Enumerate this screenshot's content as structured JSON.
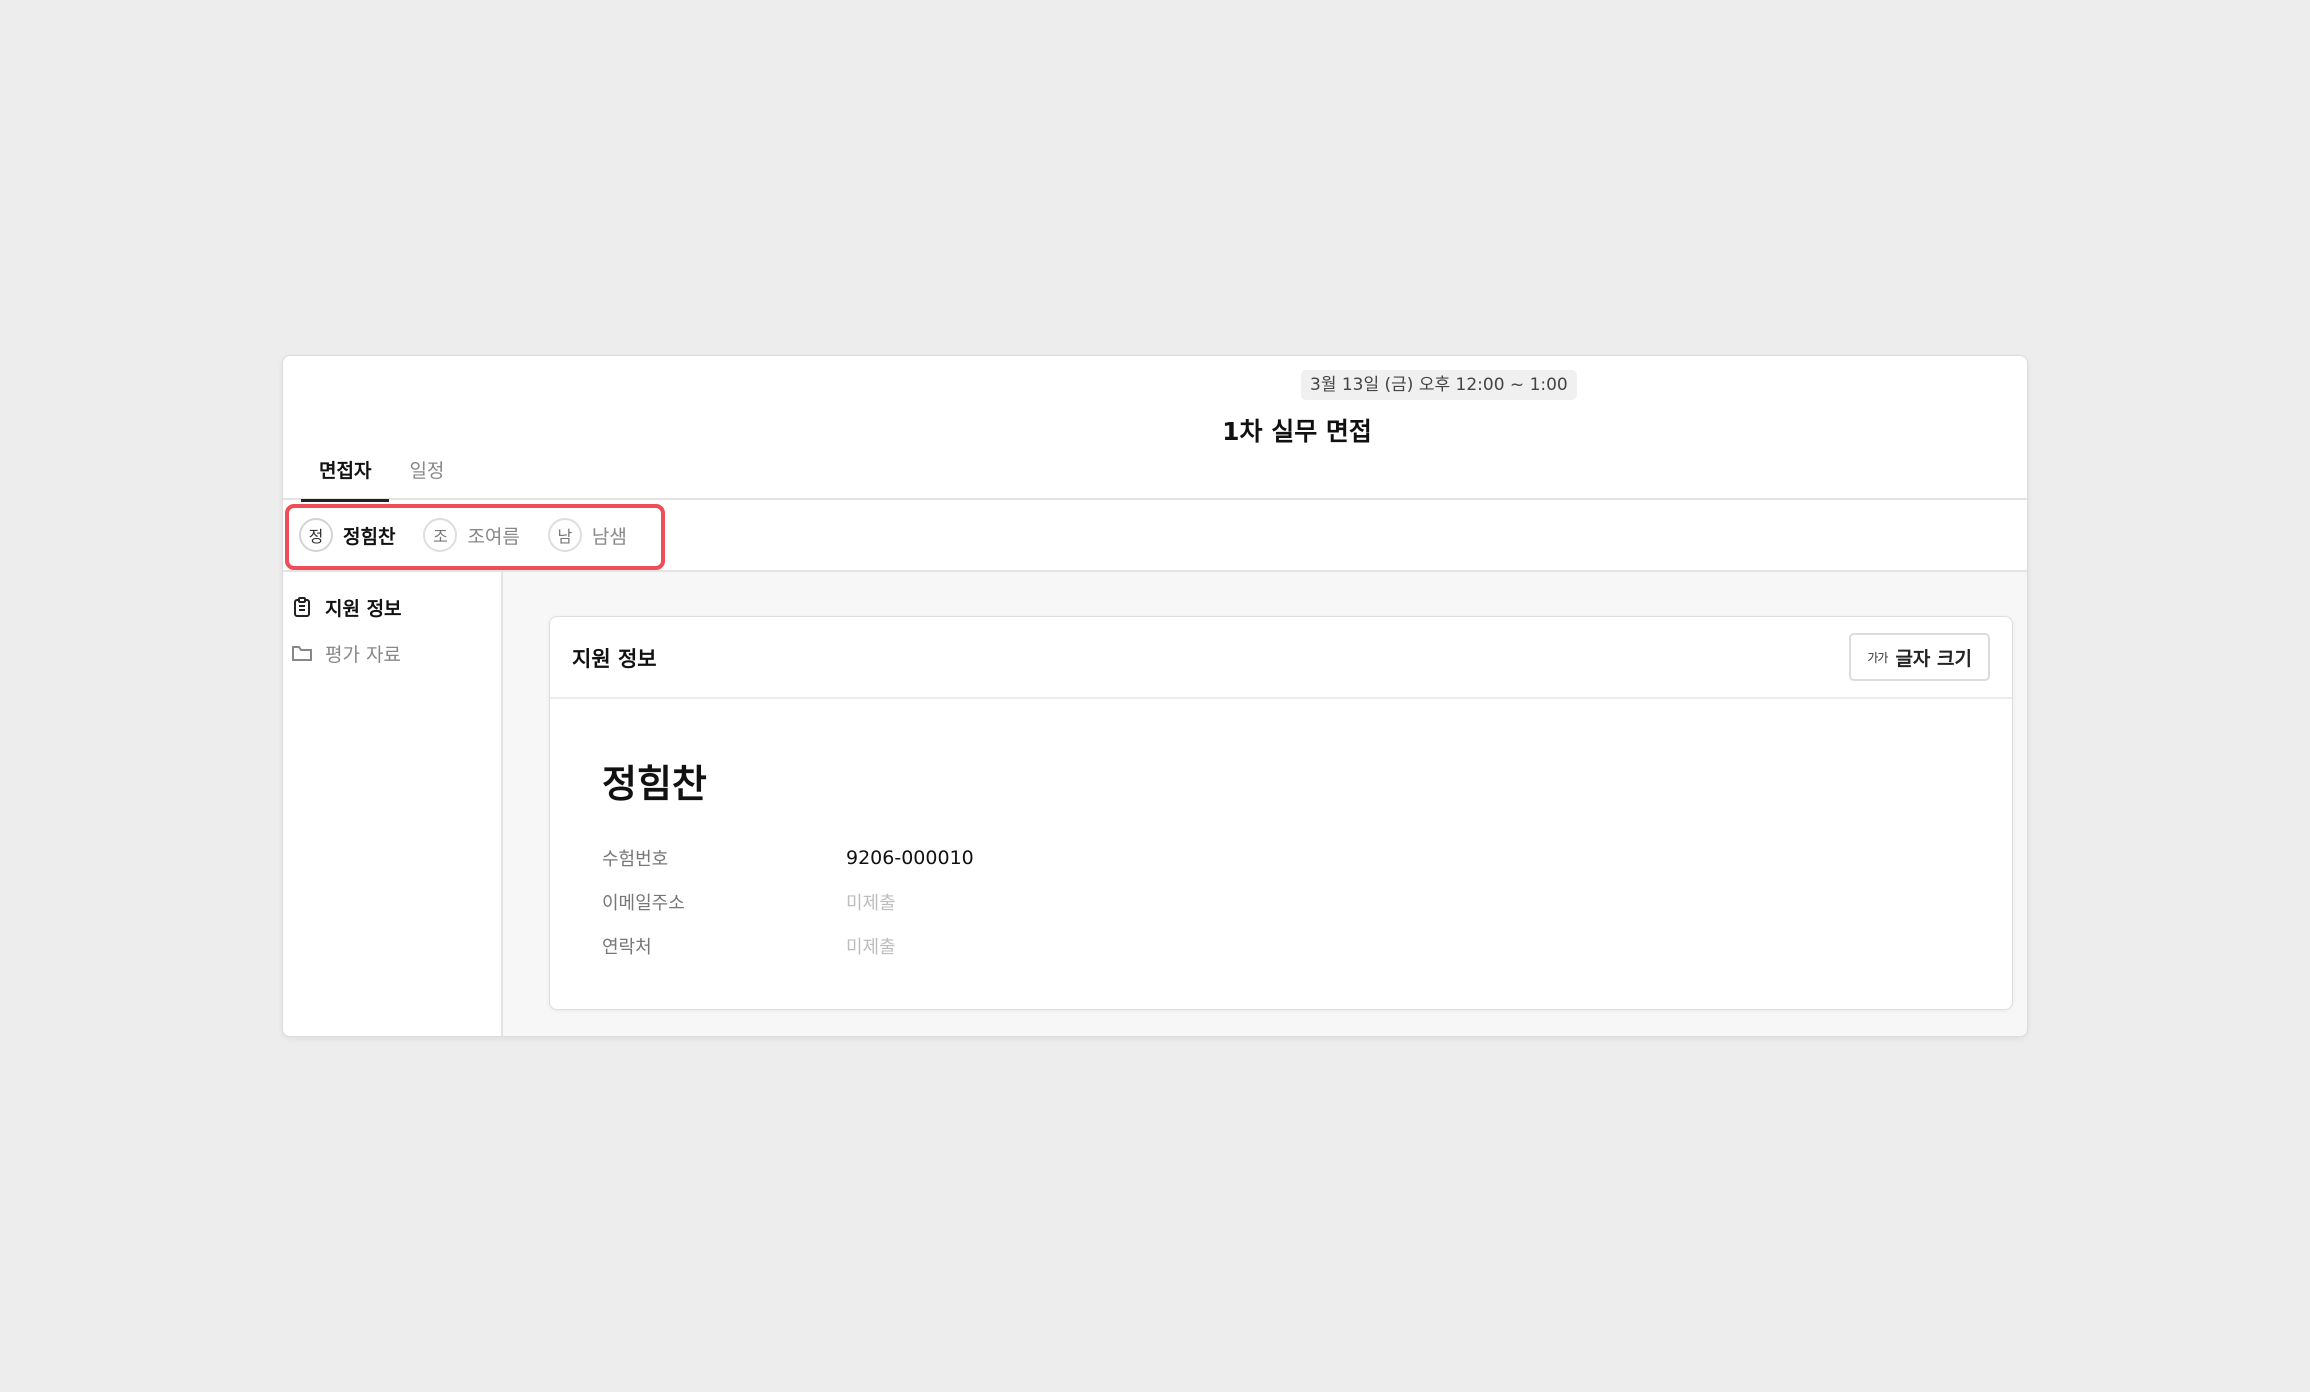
{
  "header": {
    "date": "3월 13일 (금) 오후 12:00 ~ 1:00",
    "title": "1차 실무 면접",
    "tabs": [
      {
        "label": "면접자",
        "active": true
      },
      {
        "label": "일정",
        "active": false
      }
    ]
  },
  "interviewees": [
    {
      "initial": "정",
      "name": "정힘찬",
      "active": true
    },
    {
      "initial": "조",
      "name": "조여름",
      "active": false
    },
    {
      "initial": "남",
      "name": "남샘",
      "active": false
    }
  ],
  "sidebar": {
    "items": [
      {
        "label": "지원 정보",
        "icon": "clipboard-icon",
        "active": true
      },
      {
        "label": "평가 자료",
        "icon": "folder-icon",
        "active": false
      }
    ]
  },
  "card": {
    "title": "지원 정보",
    "font_button": {
      "icon_text": "가가",
      "label": "글자 크기"
    },
    "applicant_name": "정힘찬",
    "fields": [
      {
        "label": "수험번호",
        "value": "9206-000010",
        "empty": false
      },
      {
        "label": "이메일주소",
        "value": "미제출",
        "empty": true
      },
      {
        "label": "연락처",
        "value": "미제출",
        "empty": true
      }
    ]
  },
  "colors": {
    "highlight": "#ef4d57",
    "background": "#ededed"
  }
}
